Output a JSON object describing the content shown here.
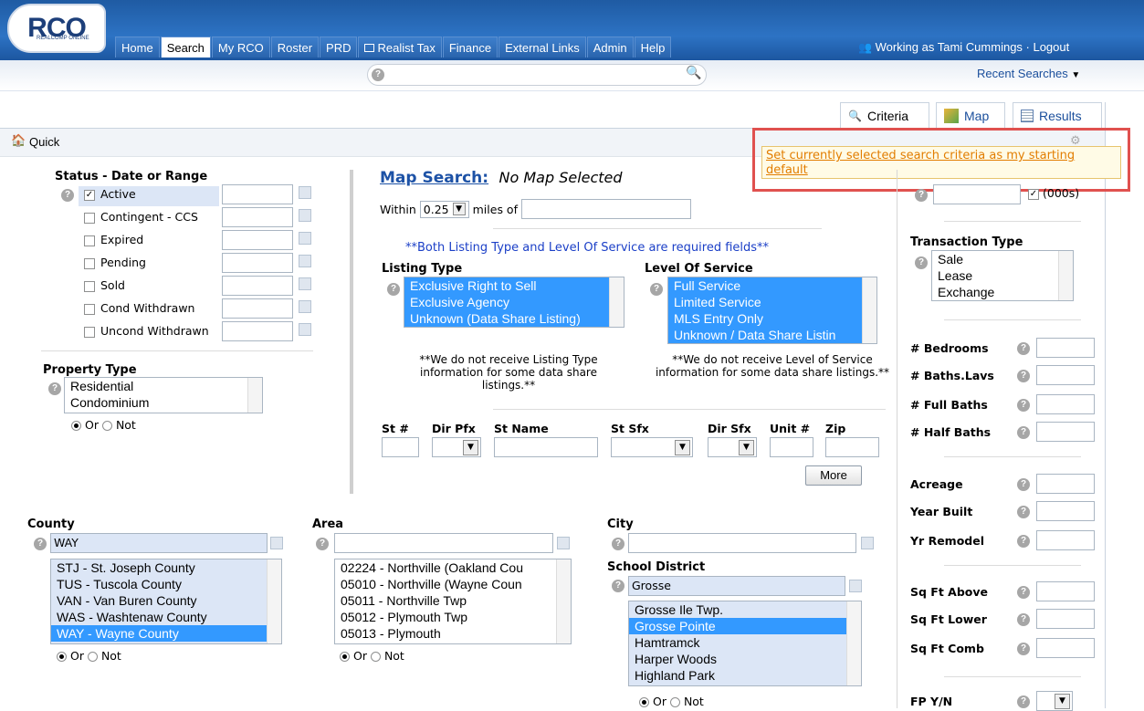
{
  "header": {
    "logo_text": "RCO",
    "logo_sub": "REALCOMP ONLINE",
    "nav": [
      "Home",
      "Search",
      "My RCO",
      "Roster",
      "PRD",
      "Realist Tax",
      "Finance",
      "External Links",
      "Admin",
      "Help"
    ],
    "user": "Working as Tami Cummings · Logout",
    "recent": "Recent Searches"
  },
  "tabs": {
    "criteria": "Criteria",
    "map": "Map",
    "results": "Results"
  },
  "quick": "Quick",
  "tooltip": "Set currently selected search criteria as my starting default",
  "status": {
    "title": "Status - Date or Range",
    "items": [
      "Active",
      "Contingent - CCS",
      "Expired",
      "Pending",
      "Sold",
      "Cond Withdrawn",
      "Uncond Withdrawn"
    ]
  },
  "property_type": {
    "title": "Property Type",
    "items": [
      "Residential",
      "Condominium"
    ]
  },
  "or_label": "Or",
  "not_label": "Not",
  "map_search": {
    "title": "Map Search:",
    "status": "No Map Selected",
    "within": "Within",
    "miles_value": "0.25",
    "miles_of": "miles of"
  },
  "required_note": "**Both Listing Type and Level Of Service are required fields**",
  "listing_type": {
    "title": "Listing Type",
    "items": [
      "Exclusive Right to Sell",
      "Exclusive Agency",
      "Unknown (Data Share Listing)"
    ],
    "note": "**We do not receive Listing Type information for some data share listings.**"
  },
  "level_of_service": {
    "title": "Level Of Service",
    "items": [
      "Full Service",
      "Limited Service",
      "MLS Entry Only",
      "Unknown / Data Share Listin"
    ],
    "note": "**We do not receive Level of Service information for some data share listings.**"
  },
  "address": {
    "st_no": "St #",
    "dir_pfx": "Dir Pfx",
    "st_name": "St Name",
    "st_sfx": "St Sfx",
    "dir_sfx": "Dir Sfx",
    "unit": "Unit #",
    "zip": "Zip",
    "more": "More"
  },
  "county": {
    "title": "County",
    "input": "WAY",
    "items": [
      "STJ - St. Joseph County",
      "TUS - Tuscola County",
      "VAN - Van Buren County",
      "WAS - Washtenaw County",
      "WAY - Wayne County"
    ]
  },
  "area": {
    "title": "Area",
    "items": [
      "02224 - Northville (Oakland Cou",
      "05010 - Northville (Wayne Coun",
      "05011 - Northville Twp",
      "05012 - Plymouth Twp",
      "05013 - Plymouth"
    ]
  },
  "city": {
    "title": "City"
  },
  "school": {
    "title": "School District",
    "input": "Grosse",
    "items": [
      "Grosse Ile Twp.",
      "Grosse Pointe",
      "Hamtramck",
      "Harper Woods",
      "Highland Park"
    ]
  },
  "right": {
    "price_unit": "(000s)",
    "transaction": {
      "title": "Transaction Type",
      "items": [
        "Sale",
        "Lease",
        "Exchange"
      ]
    },
    "fields1": [
      "# Bedrooms",
      "# Baths.Lavs",
      "# Full Baths",
      "# Half Baths"
    ],
    "fields2": [
      "Acreage",
      "Year Built",
      "Yr Remodel"
    ],
    "fields3": [
      "Sq Ft Above",
      "Sq Ft Lower",
      "Sq Ft Comb"
    ],
    "fields4": [
      "FP Y/N"
    ]
  }
}
